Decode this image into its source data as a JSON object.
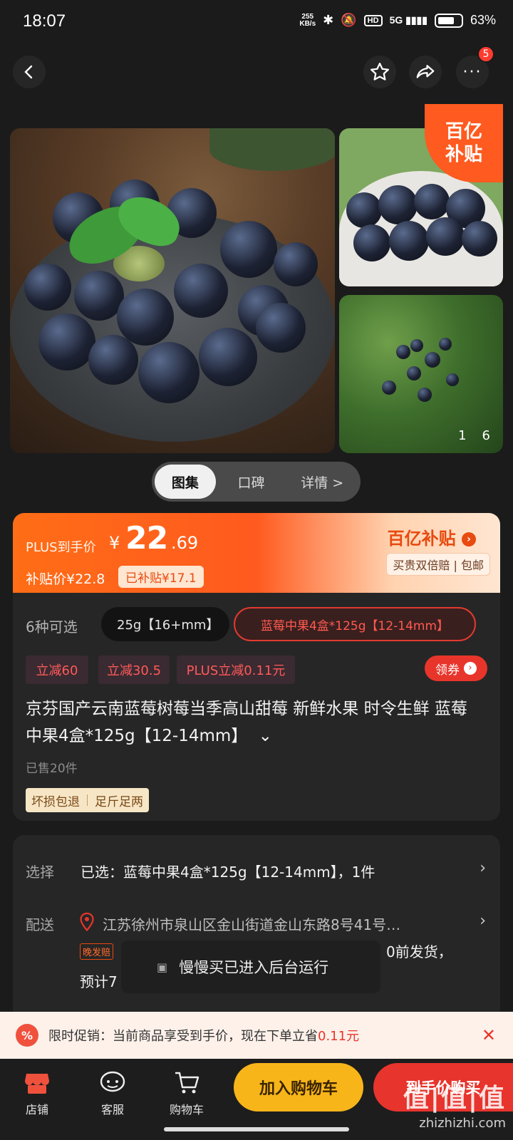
{
  "status_bar": {
    "time": "18:07",
    "net_speed_value": "255",
    "net_speed_unit": "KB/s",
    "network": "5G",
    "battery": "63%"
  },
  "nav": {
    "more_badge": "5"
  },
  "gallery": {
    "badge_line1": "百亿",
    "badge_line2": "补贴",
    "counter_current": "1",
    "counter_total": "6"
  },
  "tabs": [
    {
      "label": "图集",
      "active": true
    },
    {
      "label": "口碑"
    },
    {
      "label": "详情 >"
    }
  ],
  "price": {
    "plus_label": "PLUS到手价",
    "currency": "¥",
    "integer": "22",
    "decimal": ".69",
    "subsidy_price": "补贴价¥22.8",
    "subsidized": "已补贴¥17.1",
    "program": "百亿补贴",
    "double_refund": "买贵双倍赔 | 包邮"
  },
  "product": {
    "sku_count": "6种可选",
    "sku_options": [
      "25g【16+mm】",
      "蓝莓中果4盒*125g【12-14mm】"
    ],
    "discounts": [
      "立减60",
      "立减30.5",
      "PLUS立减0.11元"
    ],
    "coupon_label": "领券",
    "title": "京芬国产云南蓝莓树莓当季高山甜莓 新鲜水果 时令生鲜 蓝莓中果4盒*125g【12-14mm】",
    "sold": "已售20件",
    "guarantees": [
      "坏损包退",
      "足斤足两"
    ]
  },
  "selection": {
    "select_label": "选择",
    "select_value": "已选：蓝莓中果4盒*125g【12-14mm】，1件",
    "delivery_label": "配送",
    "address": "江苏徐州市泉山区金山街道金山东路8号41号…",
    "late_tag": "晚发赔",
    "ship_partial": "0前发货，",
    "eta_partial": "预计7"
  },
  "toast": {
    "text": "慢慢买已进入后台运行"
  },
  "promo": {
    "text_prefix": "限时促销：当前商品享受到手价，现在下单立省",
    "amount": "0.11元"
  },
  "bottom_bar": {
    "store": "店铺",
    "service": "客服",
    "cart": "购物车",
    "add_to_cart": "加入购物车",
    "buy_now": "到手价购买"
  },
  "watermark": {
    "brand": "值|值|值",
    "site": "zhizhizhi.com"
  },
  "colors": {
    "accent_orange": "#ff5a1f",
    "accent_red": "#e7342c",
    "cart_yellow": "#f7b51a"
  }
}
